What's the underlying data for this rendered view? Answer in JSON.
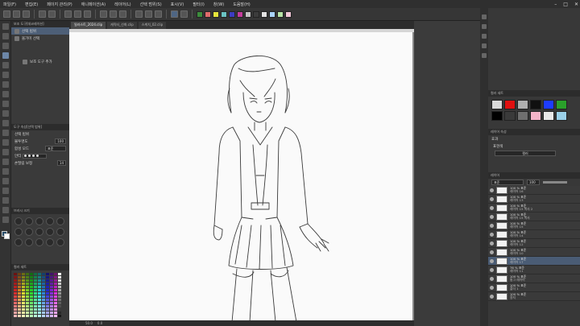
{
  "menubar": {
    "items": [
      "파일(F)",
      "편집(E)",
      "페이지 관리(P)",
      "애니메이션(A)",
      "레이어(L)",
      "선택 범위(S)",
      "표시(V)",
      "필터(I)",
      "창(W)",
      "도움말(H)"
    ]
  },
  "toolbar": {
    "swatches": [
      "#3c8c3c",
      "#e06b6b",
      "#e3e33c",
      "#6ac2c2",
      "#3c3cc2",
      "#c23c9b",
      "#c2c2c2",
      "#3c3c3c",
      "#e3e3e3",
      "#aad4ff",
      "#b7e3a6",
      "#f2c7d8"
    ]
  },
  "doc_tabs": [
    "일러스트_2024.clip",
    "캐릭터_선화.clip",
    "스케치_02.clip"
  ],
  "left_panel": {
    "header": "보조 도구[데코레이션]",
    "subtool_items": [
      "선택 범위",
      "올가미 선택"
    ],
    "add_tool": "보조 도구 추가",
    "props_header": "도구 속성[선택 범위]",
    "props": [
      {
        "label": "선택 범위",
        "value": ""
      },
      {
        "label": "불투명도",
        "value": "100"
      },
      {
        "label": "합성 모드",
        "value": "표준"
      },
      {
        "label": "안티",
        "value": ""
      },
      {
        "label": "손떨림 보정",
        "value": "14"
      }
    ],
    "brush_header": "브러시 크기",
    "color_set_header": "컬러 세트"
  },
  "right_panel": {
    "color_set_header": "컬러 세트",
    "color_set": [
      "#d9d9d9",
      "#e01010",
      "#b0b0b0",
      "#101010",
      "#1e3cff",
      "#2aa02a",
      "#000000",
      "#3a3a3a",
      "#6f6f6f",
      "#f4b3c8",
      "#e8e8e8",
      "#9ad0e8"
    ],
    "subview_header": "레이어 속성",
    "effect_label": "효과",
    "expression_label": "표현색",
    "expression_value": "컬러",
    "layer_header": "레이어",
    "blend_mode": "표준",
    "opacity": "100",
    "layers": [
      {
        "name": "100 % 표준",
        "sub": "레이어 16"
      },
      {
        "name": "100 % 표준",
        "sub": "레이어 13"
      },
      {
        "name": "100 % 표준",
        "sub": "레이어 15 복사 2"
      },
      {
        "name": "100 % 표준",
        "sub": "레이어 15 복사"
      },
      {
        "name": "100 % 표준",
        "sub": "레이어 15"
      },
      {
        "name": "100 % 표준",
        "sub": "레이어 14"
      },
      {
        "name": "100 % 표준",
        "sub": "레이어 12"
      },
      {
        "name": "100 % 표준",
        "sub": "레이어 10"
      },
      {
        "name": "100 % 표준",
        "sub": "레이어 17"
      },
      {
        "name": "76 % 표준",
        "sub": "레이어 11"
      },
      {
        "name": "100 % 표준",
        "sub": "밑그 레이어"
      },
      {
        "name": "100 % 표준",
        "sub": "폴더 1"
      },
      {
        "name": "100 % 표준",
        "sub": "용지"
      }
    ]
  },
  "status": {
    "zoom": "50.0",
    "angle": "0.0"
  }
}
